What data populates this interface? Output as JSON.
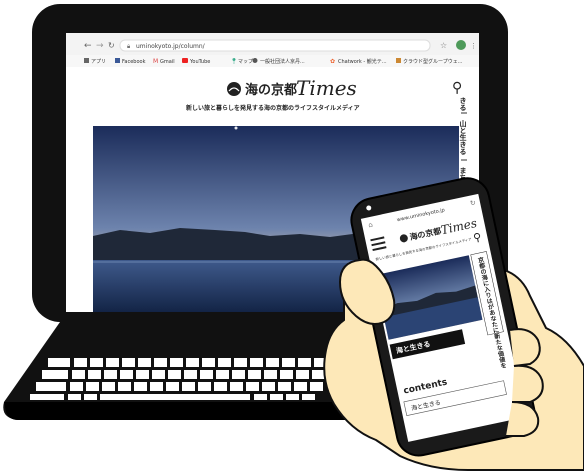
{
  "laptop": {
    "url": "uminokyoto.jp/column/",
    "bookmarks": [
      "アプリ",
      "Facebook",
      "Gmail",
      "YouTube",
      "マップ",
      "一般社団法人京丹...",
      "Chatwork - 観光テ...",
      "クラウド型グループウェ..."
    ],
    "logo_jp": "海の京都",
    "logo_en": "Times",
    "tagline": "新しい旅と暮らしを発見する海の京都のライフスタイルメディア",
    "side_labels": [
      "きる",
      "山と生きる",
      "まち"
    ]
  },
  "phone": {
    "url": "www.uminokyoto.jp",
    "logo_jp": "海の京都",
    "logo_en": "Times",
    "tagline": "新しい旅と暮らしを発見する海の京都のライフスタイルメディア",
    "feature_vertical": "京都の海に入りはがあなたに新たな価値を",
    "category_button": "海と生きる",
    "contents_heading": "contents",
    "contents_item": "海と生きる"
  },
  "colors": {
    "outline": "#111111",
    "sky_top": "#1d2f5e",
    "sky_mid": "#6e84ad",
    "sky_glow": "#e9c9a8",
    "mountain": "#202a3d",
    "water": "#243a66",
    "skin": "#fde8b8",
    "screen_bg": "#ffffff",
    "button_bg": "#111111"
  }
}
